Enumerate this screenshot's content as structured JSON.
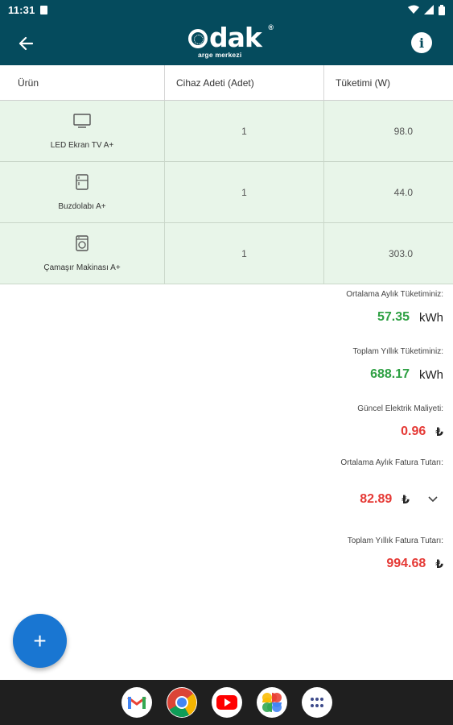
{
  "status_bar": {
    "time": "11:31"
  },
  "table": {
    "headers": [
      "Ürün",
      "Cihaz Adeti (Adet)",
      "Tüketimi (W)"
    ],
    "rows": [
      {
        "name": "LED Ekran TV A+",
        "icon": "tv-icon",
        "count": "1",
        "watts": "98.0"
      },
      {
        "name": "Buzdolabı A+",
        "icon": "fridge-icon",
        "count": "1",
        "watts": "44.0"
      },
      {
        "name": "Çamaşır Makinası A+",
        "icon": "washing-machine-icon",
        "count": "1",
        "watts": "303.0"
      }
    ]
  },
  "summary": {
    "monthly_label": "Ortalama Aylık Tüketiminiz:",
    "monthly_value": "57.35",
    "monthly_unit": "kWh",
    "yearly_label": "Toplam Yıllık Tüketiminiz:",
    "yearly_value": "688.17",
    "yearly_unit": "kWh",
    "cost_label": "Güncel Elektrik Maliyeti:",
    "cost_value": "0.96",
    "currency": "₺",
    "monthly_bill_label": "Ortalama Aylık Fatura Tutarı:",
    "monthly_bill_value": "82.89",
    "yearly_bill_label": "Toplam Yıllık Fatura Tutarı:",
    "yearly_bill_value": "994.68"
  },
  "app_bar": {
    "logo_text": "dak",
    "logo_subtitle": "arge merkezi",
    "logo_reg": "®",
    "info_symbol": "i"
  },
  "fab": {
    "symbol": "+"
  },
  "colors": {
    "primary": "#054b5d",
    "row_bg": "#e8f5e9",
    "green": "#2ea043",
    "red": "#e53935",
    "fab": "#1976d2"
  }
}
